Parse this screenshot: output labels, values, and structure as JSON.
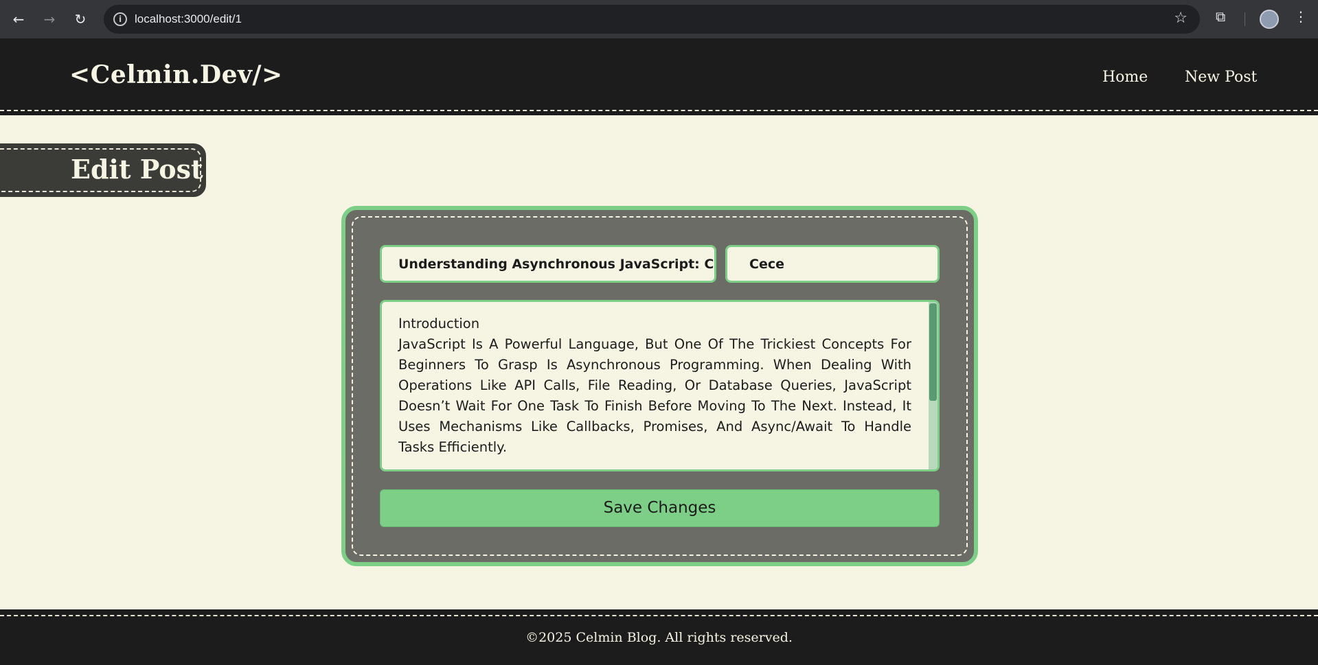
{
  "browser": {
    "url": "localhost:3000/edit/1",
    "icons": {
      "back": "arrow-left-icon",
      "forward": "arrow-right-icon",
      "reload": "reload-icon",
      "site_info": "info-icon",
      "bookmark": "star-icon",
      "extensions": "puzzle-icon",
      "profile": "avatar",
      "menu": "kebab-menu-icon"
    }
  },
  "header": {
    "logo": "<Celmin.Dev/>",
    "nav": [
      {
        "label": "Home"
      },
      {
        "label": "New Post"
      }
    ]
  },
  "page": {
    "title": "Edit Post"
  },
  "form": {
    "title_value": "Understanding Asynchronous JavaScript: Callbacks, Promises, and Async/Await",
    "author_value": "Cece",
    "content_heading": "Introduction",
    "content_body": "JavaScript Is A Powerful Language, But One Of The Trickiest Concepts For Beginners To Grasp Is Asynchronous Programming. When Dealing With Operations Like API Calls, File Reading, Or Database Queries, JavaScript Doesn’t Wait For One Task To Finish Before Moving To The Next. Instead, It Uses Mechanisms Like Callbacks, Promises, And Async/Await To Handle Tasks Efficiently.",
    "save_label": "Save Changes"
  },
  "footer": {
    "copyright": "©2025 Celmin Blog. All rights reserved."
  },
  "colors": {
    "accent": "#7dcf87",
    "dark": "#1c1c1c",
    "cream": "#f6f4e3",
    "card": "#6b6c65"
  }
}
